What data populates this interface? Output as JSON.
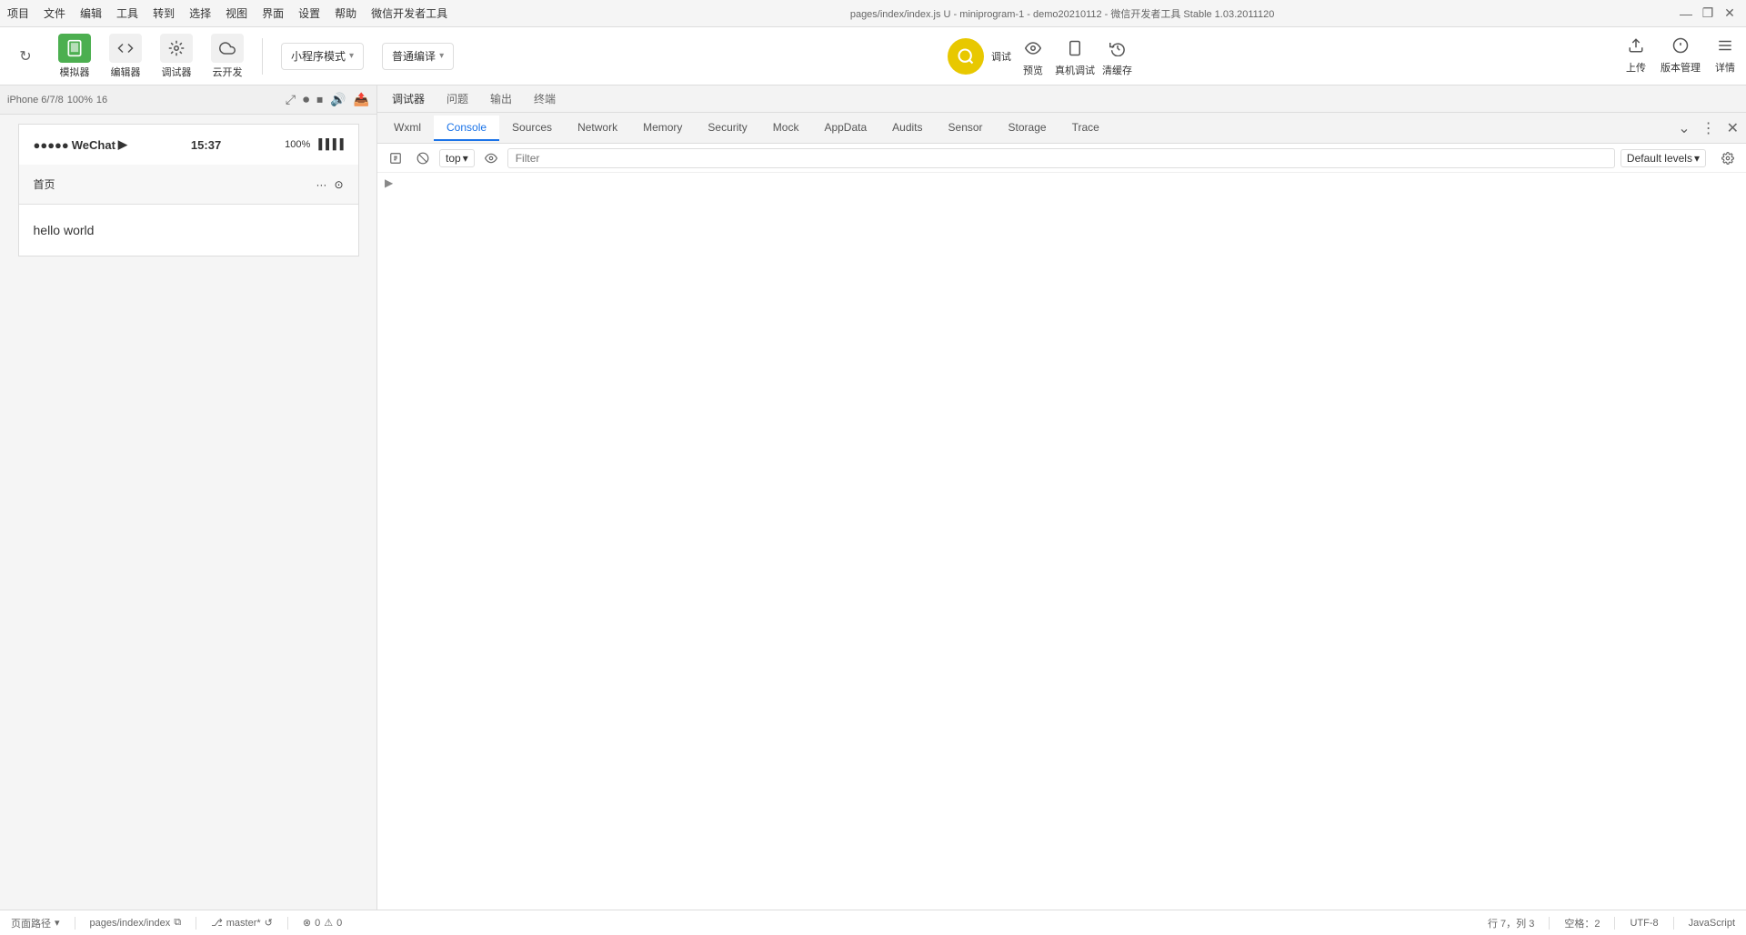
{
  "titlebar": {
    "menu": [
      "项目",
      "文件",
      "编辑",
      "工具",
      "转到",
      "选择",
      "视图",
      "界面",
      "设置",
      "帮助",
      "微信开发者工具"
    ],
    "title": "pages/index/index.js U - miniprogram-1 - demo20210112 - 微信开发者工具 Stable 1.03.2011120",
    "controls": [
      "—",
      "❐",
      "✕"
    ]
  },
  "toolbar": {
    "refresh_icon": "↻",
    "simulator_label": "模拟器",
    "editor_label": "编辑器",
    "debugger_label": "调试器",
    "cloud_label": "云开发",
    "mode_label": "小程序模式",
    "mode_arrow": "▾",
    "compile_label": "普通编译",
    "compile_arrow": "▾",
    "debug_icon": "🔍",
    "debug_label": "调试",
    "preview_icon": "👁",
    "preview_label": "预览",
    "device_icon": "📱",
    "device_label": "真机调试",
    "clear_icon": "🗑",
    "clear_label": "清缓存",
    "upload_icon": "⬆",
    "upload_label": "上传",
    "version_icon": "📋",
    "version_label": "版本管理",
    "detail_icon": "≡",
    "detail_label": "详情"
  },
  "simulator": {
    "device": "iPhone 6/7/8",
    "scale": "100%",
    "scale_num": "16",
    "rotate_icon": "⤢",
    "controls": [
      "⊙",
      "⏹",
      "🔊",
      "📤"
    ],
    "status_time": "15:37",
    "status_left": "●●●●● WeChat ▶",
    "status_right": "100% ▐▐▐▐",
    "nav_title": "首页",
    "nav_icons": [
      "···",
      "⊙"
    ],
    "content": "hello world"
  },
  "devtools_toolbar": {
    "tabs": [
      "调试器",
      "问题",
      "输出",
      "终端"
    ]
  },
  "dev_tabs": {
    "tabs": [
      {
        "label": "Wxml",
        "active": false
      },
      {
        "label": "Console",
        "active": true
      },
      {
        "label": "Sources",
        "active": false
      },
      {
        "label": "Network",
        "active": false
      },
      {
        "label": "Memory",
        "active": false
      },
      {
        "label": "Security",
        "active": false
      },
      {
        "label": "Mock",
        "active": false
      },
      {
        "label": "AppData",
        "active": false
      },
      {
        "label": "Audits",
        "active": false
      },
      {
        "label": "Sensor",
        "active": false
      },
      {
        "label": "Storage",
        "active": false
      },
      {
        "label": "Trace",
        "active": false
      }
    ]
  },
  "console_toolbar": {
    "prohibit_icon": "🚫",
    "pause_icon": "⊙",
    "top_label": "top",
    "top_arrow": "▾",
    "eye_icon": "👁",
    "filter_placeholder": "Filter",
    "levels_label": "Default levels",
    "levels_arrow": "▾",
    "settings_icon": "⚙"
  },
  "statusbar": {
    "path_label": "页面路径",
    "path_arrow": "▾",
    "path_value": "pages/index/index",
    "copy_icon": "⧉",
    "branch_icon": "⎇",
    "branch_name": "master*",
    "sync_icon": "↺",
    "error_count": "0",
    "warning_count": "0",
    "row_label": "行 7，列 3",
    "space_label": "空格：2",
    "encoding": "UTF-8",
    "language": "JavaScript"
  }
}
